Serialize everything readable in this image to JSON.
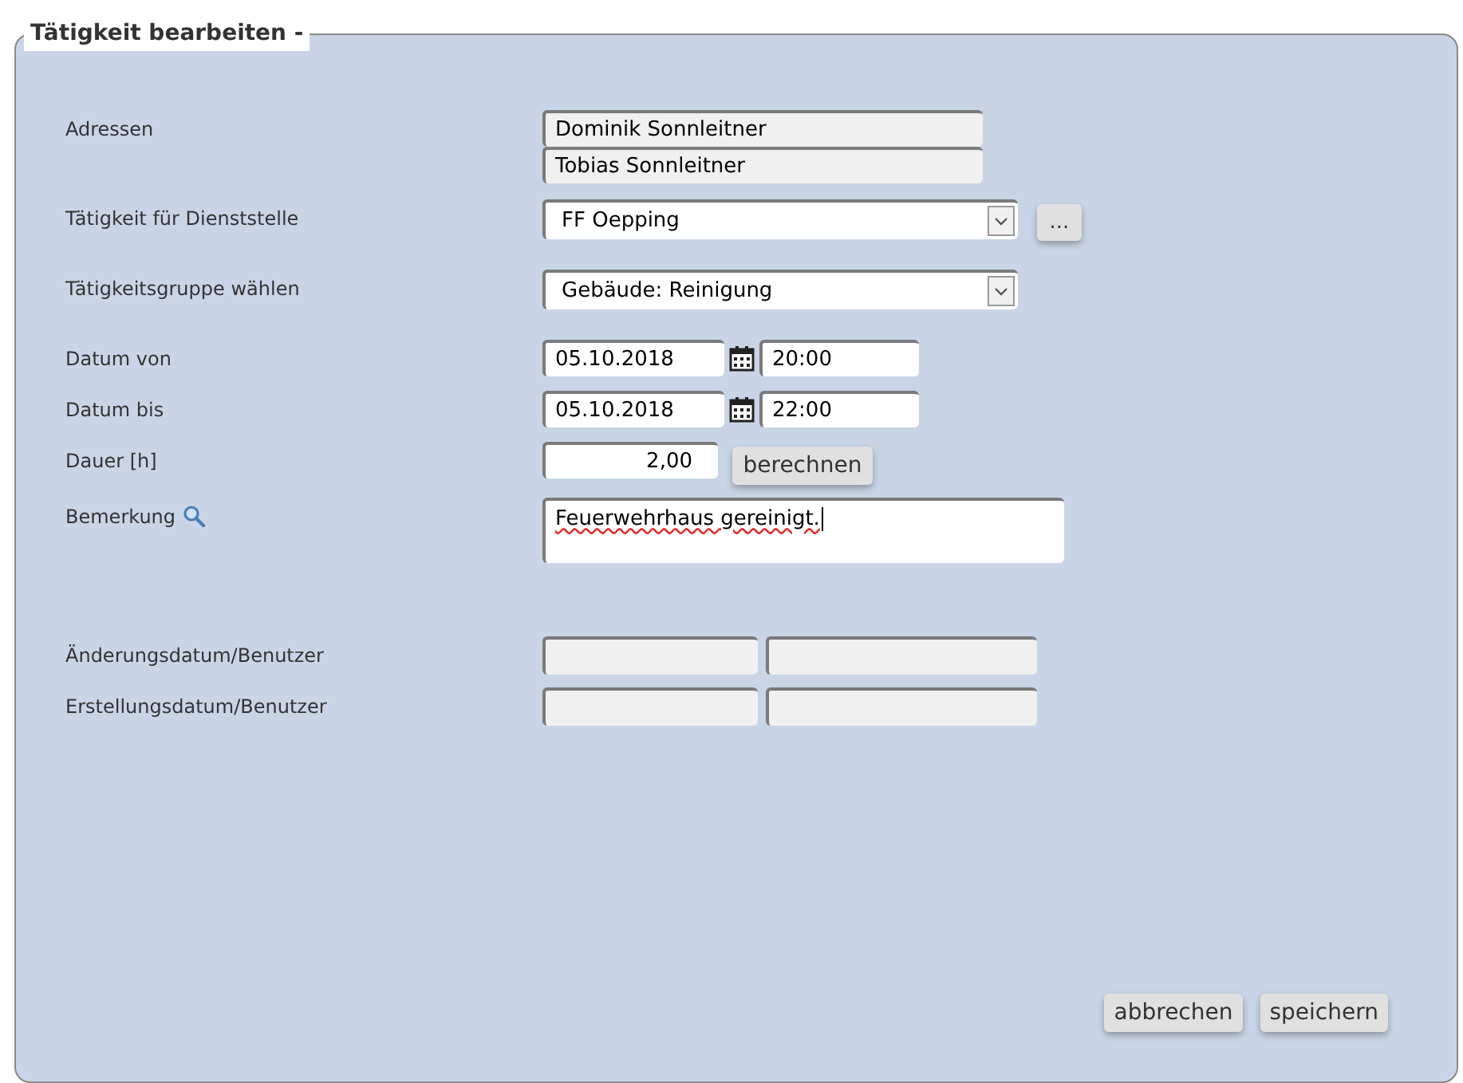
{
  "legend": "Tätigkeit bearbeiten -",
  "rows": [
    {
      "kind": "address_list",
      "label": "Adressen",
      "values": [
        "Dominik Sonnleitner",
        "Tobias Sonnleitner"
      ]
    },
    {
      "kind": "select",
      "label": "Tätigkeit für Dienststelle",
      "value": "FF Oepping",
      "button": "..."
    },
    {
      "kind": "select",
      "label": "Tätigkeitsgruppe wählen",
      "value": "Gebäude: Reinigung"
    },
    {
      "kind": "datetime",
      "label": "Datum von",
      "date": "05.10.2018",
      "time": "20:00"
    },
    {
      "kind": "datetime",
      "label": "Datum bis",
      "date": "05.10.2018",
      "time": "22:00"
    },
    {
      "kind": "number",
      "label": "Dauer [h]",
      "value": "2,00",
      "button": "berechnen"
    },
    {
      "kind": "textarea",
      "label": "Bemerkung",
      "value": "Feuerwehrhaus gereinigt."
    },
    {
      "kind": "readonly_pair",
      "label": "Änderungsdatum/Benutzer"
    },
    {
      "kind": "readonly_pair",
      "label": "Erstellungsdatum/Benutzer"
    }
  ],
  "buttons": [
    "abbrechen",
    "speichern"
  ]
}
